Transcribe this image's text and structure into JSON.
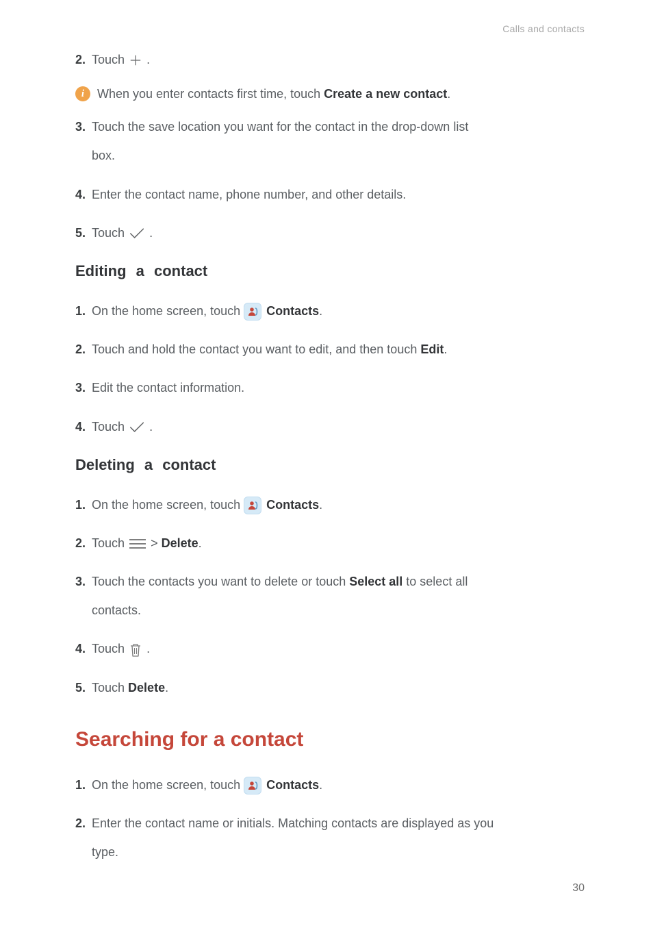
{
  "header": {
    "breadcrumb": "Calls and contacts"
  },
  "pre_steps": {
    "s2": {
      "num": "2.",
      "text": "Touch ",
      "tail": " ."
    },
    "info": {
      "prefix": "When you enter contacts first time, touch ",
      "bold": "Create a new contact",
      "suffix": "."
    },
    "s3": {
      "num": "3.",
      "text": "Touch the save location you want for the contact in the drop-down list ",
      "line2": "box."
    },
    "s4": {
      "num": "4.",
      "text": "Enter the contact name, phone number, and other details."
    },
    "s5": {
      "num": "5.",
      "text": "Touch ",
      "tail": " ."
    }
  },
  "editing": {
    "title": "Editing a contact",
    "s1": {
      "num": "1.",
      "text": "On the home screen, touch ",
      "bold": "Contacts",
      "suffix": "."
    },
    "s2": {
      "num": "2.",
      "text": "Touch and hold the contact you want to edit, and then touch ",
      "bold": "Edit",
      "suffix": "."
    },
    "s3": {
      "num": "3.",
      "text": "Edit the contact information."
    },
    "s4": {
      "num": "4.",
      "text": "Touch ",
      "tail": " ."
    }
  },
  "deleting": {
    "title": "Deleting a contact",
    "s1": {
      "num": "1.",
      "text": "On the home screen, touch ",
      "bold": "Contacts",
      "suffix": "."
    },
    "s2": {
      "num": "2.",
      "text": "Touch ",
      "mid": " > ",
      "bold": "Delete",
      "suffix": "."
    },
    "s3": {
      "num": "3.",
      "text": "Touch the contacts you want to delete or touch ",
      "bold": "Select all",
      "suffix": " to select all ",
      "line2": "contacts."
    },
    "s4": {
      "num": "4.",
      "text": "Touch ",
      "tail": " ."
    },
    "s5": {
      "num": "5.",
      "text": "Touch ",
      "bold": "Delete",
      "suffix": "."
    }
  },
  "searching": {
    "title": "Searching for a contact",
    "s1": {
      "num": "1.",
      "text": "On the home screen, touch ",
      "bold": "Contacts",
      "suffix": "."
    },
    "s2": {
      "num": "2.",
      "text": "Enter the contact name or initials. Matching contacts are displayed as you ",
      "line2": "type."
    }
  },
  "footer": {
    "page": "30"
  }
}
